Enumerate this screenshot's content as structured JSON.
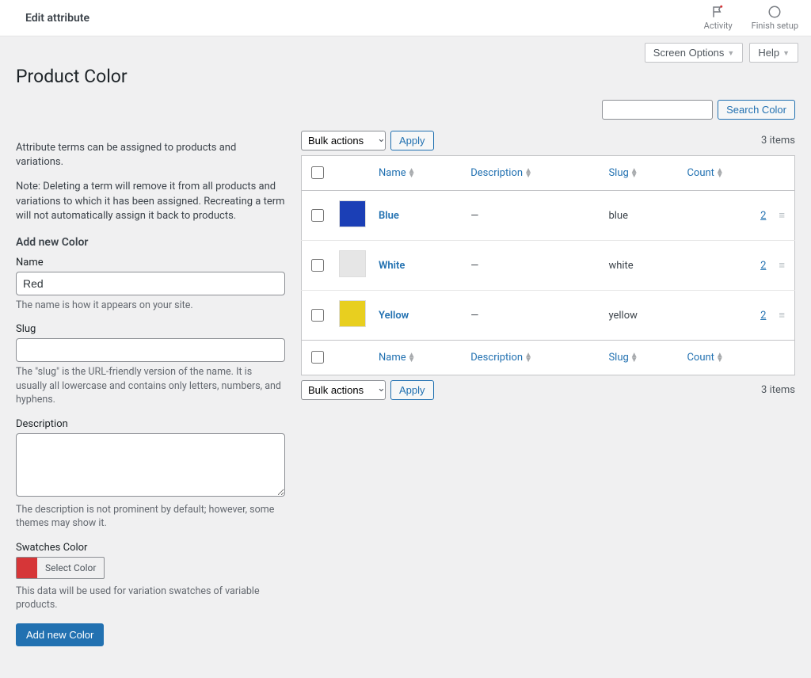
{
  "topbar": {
    "title": "Edit attribute",
    "activity_label": "Activity",
    "finish_setup_label": "Finish setup"
  },
  "tabs": {
    "screen_options": "Screen Options",
    "help": "Help"
  },
  "page_title": "Product Color",
  "intro_text": "Attribute terms can be assigned to products and variations.",
  "note_text": "Note: Deleting a term will remove it from all products and variations to which it has been assigned. Recreating a term will not automatically assign it back to products.",
  "add_heading": "Add new Color",
  "form": {
    "name_label": "Name",
    "name_value": "Red",
    "name_help": "The name is how it appears on your site.",
    "slug_label": "Slug",
    "slug_value": "",
    "slug_help": "The \"slug\" is the URL-friendly version of the name. It is usually all lowercase and contains only letters, numbers, and hyphens.",
    "description_label": "Description",
    "description_value": "",
    "description_help": "The description is not prominent by default; however, some themes may show it.",
    "swatch_label": "Swatches Color",
    "swatch_select_label": "Select Color",
    "swatch_help": "This data will be used for variation swatches of variable products.",
    "swatch_color": "#d63638",
    "submit_label": "Add new Color"
  },
  "search": {
    "placeholder": "",
    "button_label": "Search Color"
  },
  "bulk": {
    "placeholder": "Bulk actions",
    "apply_label": "Apply"
  },
  "item_count_text": "3 items",
  "columns": {
    "name": "Name",
    "description": "Description",
    "slug": "Slug",
    "count": "Count"
  },
  "rows": [
    {
      "name": "Blue",
      "description": "—",
      "slug": "blue",
      "count": "2",
      "swatch": "#1b3fb6"
    },
    {
      "name": "White",
      "description": "—",
      "slug": "white",
      "count": "2",
      "swatch": "#e6e6e6"
    },
    {
      "name": "Yellow",
      "description": "—",
      "slug": "yellow",
      "count": "2",
      "swatch": "#e8cf1f"
    }
  ]
}
